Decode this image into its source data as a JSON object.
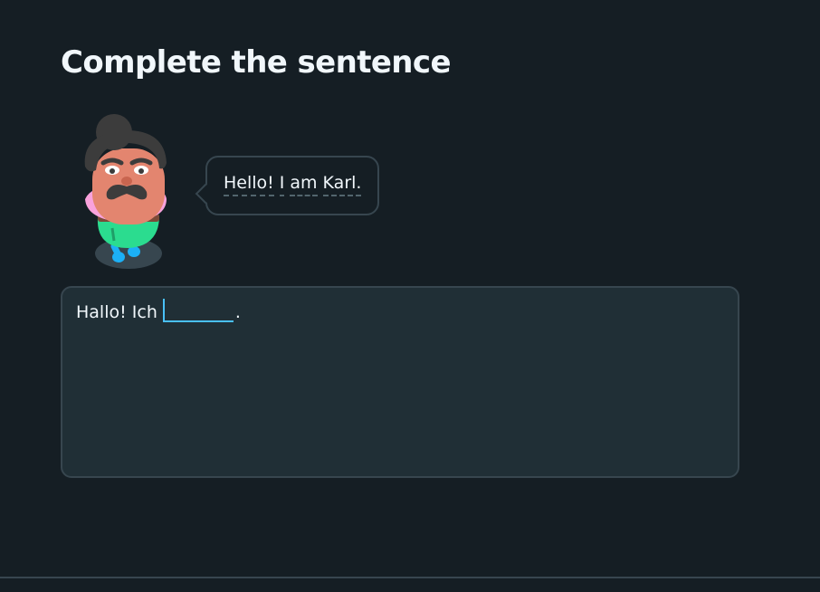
{
  "header": {
    "title": "Complete the sentence"
  },
  "speech_bubble": {
    "words": [
      "Hello!",
      "I",
      "am",
      "Karl."
    ]
  },
  "exercise": {
    "prefix": "Hallo! Ich",
    "blank_value": "",
    "suffix": "."
  },
  "colors": {
    "background": "#151e24",
    "panel": "#202f36",
    "border": "#37464f",
    "accent": "#49c0f8",
    "text": "#f1f7fb"
  },
  "icons": {
    "character": "karl-character-icon"
  }
}
